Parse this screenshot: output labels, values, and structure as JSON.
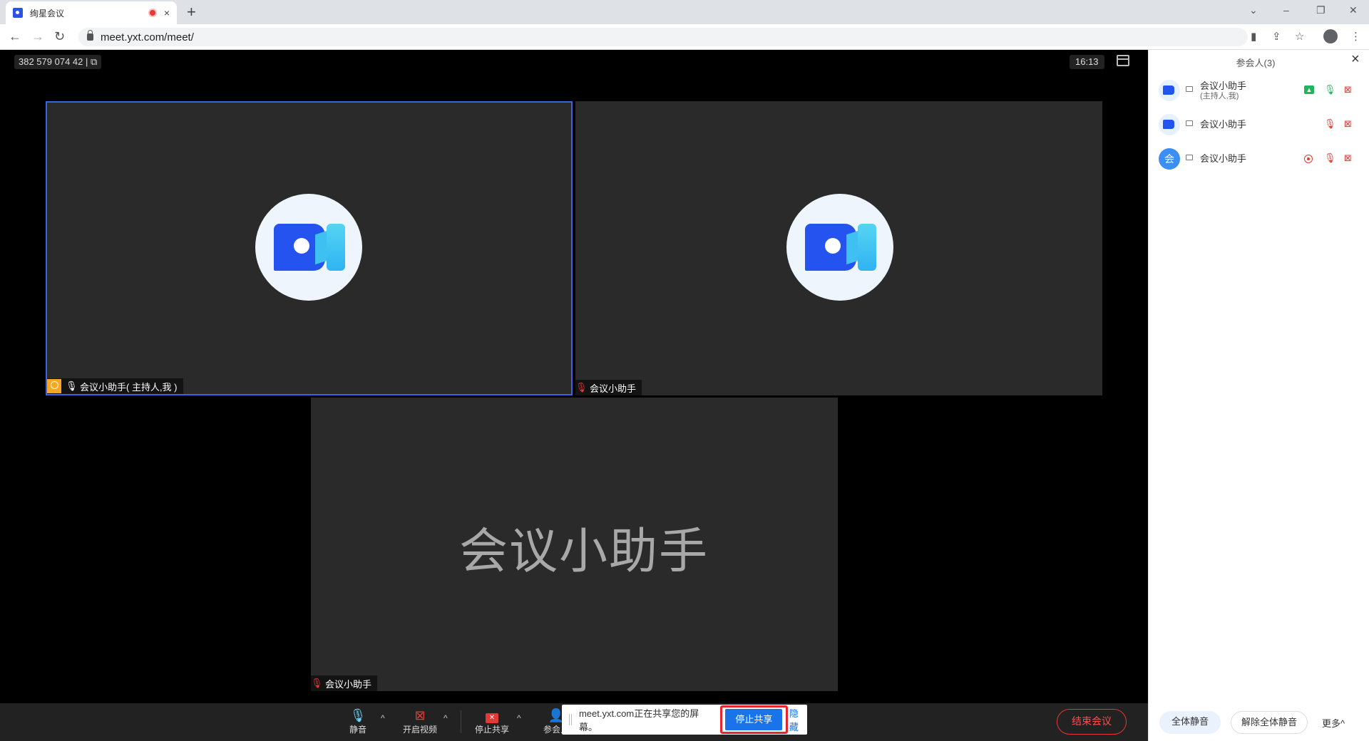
{
  "browser": {
    "tab_title": "绚星会议",
    "tab_close": "×",
    "new_tab": "+",
    "url": "meet.yxt.com/meet/"
  },
  "meeting": {
    "meeting_id": "382 579 074 42 | ⧉",
    "time": "16:13",
    "tiles": [
      {
        "name": "会议小助手( 主持人,我 )",
        "mic": "on"
      },
      {
        "name": "会议小助手",
        "mic": "off"
      },
      {
        "name": "会议小助手",
        "mic": "off",
        "big_name": "会议小助手"
      }
    ]
  },
  "toolbar": {
    "mute": "静音",
    "video": "开启视频",
    "stop_share": "停止共享",
    "participants": "参会人",
    "end": "结束会议"
  },
  "share_bar": {
    "message": "meet.yxt.com正在共享您的屏幕。",
    "stop": "停止共享",
    "hide": "隐藏"
  },
  "panel": {
    "title": "参会人(3)",
    "participants": [
      {
        "name": "会议小助手",
        "sub": "(主持人,我)",
        "avatar": "logo"
      },
      {
        "name": "会议小助手",
        "sub": "",
        "avatar": "logo"
      },
      {
        "name": "会议小助手",
        "sub": "",
        "avatar": "会"
      }
    ],
    "mute_all": "全体静音",
    "unmute_all": "解除全体静音",
    "more": "更多^"
  },
  "colors": {
    "accent": "#3a63e6",
    "danger": "#e53935",
    "primary_btn": "#1a73e8"
  },
  "icons": [
    "favicon",
    "record-icon",
    "back-icon",
    "forward-icon",
    "reload-icon",
    "lock-icon",
    "camera-icon",
    "share-icon",
    "star-icon",
    "profile-icon",
    "menu-icon",
    "mic-icon",
    "video-off-icon",
    "stop-share-icon",
    "participants-icon",
    "close-icon"
  ]
}
